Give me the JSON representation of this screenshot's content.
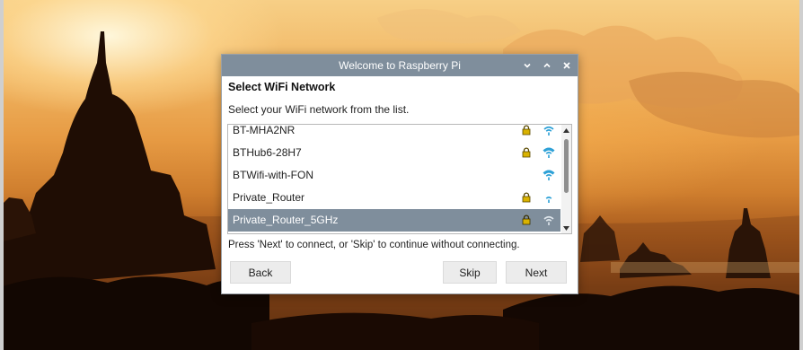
{
  "window": {
    "title": "Welcome to Raspberry Pi",
    "controls": [
      "minimize-icon",
      "maximize-icon",
      "close-icon"
    ]
  },
  "dialog": {
    "heading": "Select WiFi Network",
    "subtitle": "Select your WiFi network from the list.",
    "networks": [
      {
        "name": "BT-MHA2NR",
        "secured": true,
        "signal_icon": "wifi-icon",
        "selected": false
      },
      {
        "name": "BTHub6-28H7",
        "secured": true,
        "signal_icon": "wifi-icon",
        "selected": false
      },
      {
        "name": "BTWifi-with-FON",
        "secured": false,
        "signal_icon": "wifi-icon",
        "selected": false
      },
      {
        "name": "Private_Router",
        "secured": true,
        "signal_icon": "wifi-icon",
        "selected": false
      },
      {
        "name": "Private_Router_5GHz",
        "secured": true,
        "signal_icon": "wifi-icon",
        "selected": true
      }
    ],
    "hint": "Press 'Next' to connect, or 'Skip' to continue without connecting.",
    "buttons": {
      "back": "Back",
      "skip": "Skip",
      "next": "Next"
    }
  },
  "colors": {
    "titlebar": "#7f8e9c",
    "selected_row": "#7f8e9c",
    "wifi_icon": "#2a9fd6",
    "lock_icon": "#d9b200"
  }
}
